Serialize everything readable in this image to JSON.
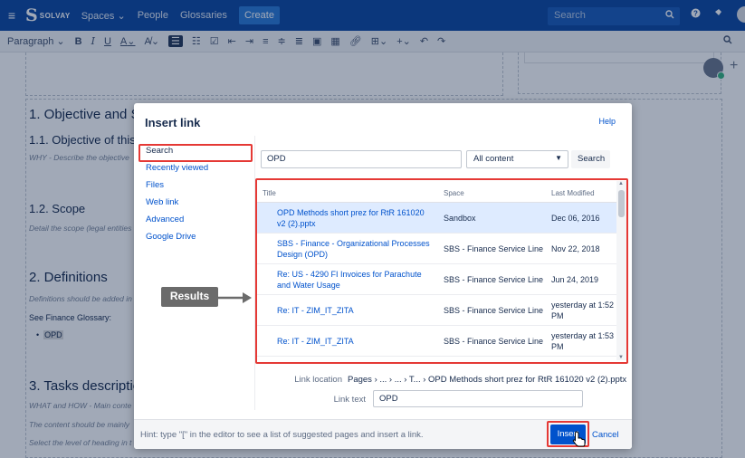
{
  "topnav": {
    "brand": "SOLVAY",
    "items": [
      "Spaces",
      "People",
      "Glossaries"
    ],
    "spaces_caret": "⌄",
    "create_label": "Create",
    "search_placeholder": "Search"
  },
  "toolbar": {
    "paragraph_label": "Paragraph",
    "bold": "B",
    "italic": "I",
    "underline": "U",
    "text_color": "A",
    "more_format": "A̸"
  },
  "editor": {
    "h1_objective": "1. Objective and S",
    "h2_objective": "1.1. Objective of this",
    "hint_objective": "WHY - Describe the objective",
    "h2_scope": "1.2. Scope",
    "hint_scope": "Detail the scope (legal entities",
    "h1_definitions": "2. Definitions",
    "hint_definitions": "Definitions should be added in",
    "see_glossary": "See Finance Glossary:",
    "bullet_opd": "OPD",
    "h1_tasks": "3. Tasks descriptio",
    "hint_tasks1": "WHAT and HOW - Main conte",
    "hint_tasks2": "The content should be mainly",
    "hint_tasks3": "Select the level of heading in t"
  },
  "dialog": {
    "title": "Insert link",
    "help_label": "Help",
    "sidebar": [
      {
        "label": "Search",
        "active": true
      },
      {
        "label": "Recently viewed",
        "active": false
      },
      {
        "label": "Files",
        "active": false
      },
      {
        "label": "Web link",
        "active": false
      },
      {
        "label": "Advanced",
        "active": false
      },
      {
        "label": "Google Drive",
        "active": false
      }
    ],
    "search_value": "OPD",
    "content_filter": "All content",
    "search_button": "Search",
    "columns": {
      "title": "Title",
      "space": "Space",
      "modified": "Last Modified"
    },
    "results": [
      {
        "title": "OPD Methods short prez for RtR 161020 v2 (2).pptx",
        "space": "Sandbox",
        "modified": "Dec 06, 2016",
        "selected": true
      },
      {
        "title": "SBS - Finance - Organizational Processes Design (OPD)",
        "space": "SBS - Finance Service Line",
        "modified": "Nov 22, 2018",
        "selected": false
      },
      {
        "title": "Re: US - 4290 FI Invoices for Parachute and Water Usage",
        "space": "SBS - Finance Service Line",
        "modified": "Jun 24, 2019",
        "selected": false
      },
      {
        "title": "Re: IT - ZIM_IT_ZITA",
        "space": "SBS - Finance Service Line",
        "modified": "yesterday at 1:52 PM",
        "selected": false
      },
      {
        "title": "Re: IT - ZIM_IT_ZITA",
        "space": "SBS - Finance Service Line",
        "modified": "yesterday at 1:53 PM",
        "selected": false
      }
    ],
    "annotation_label": "Results",
    "link_location_label": "Link location",
    "link_location_value": "Pages › ... › ... › T... › OPD Methods short prez for RtR 161020 v2 (2).pptx",
    "link_text_label": "Link text",
    "link_text_value": "OPD",
    "footer_hint": "Hint: type \"[\" in the editor to see a list of suggested pages and insert a link.",
    "insert_button": "Insert",
    "cancel_link": "Cancel"
  },
  "colors": {
    "nav_blue": "#0d47a1",
    "link_blue": "#0052cc",
    "highlight_red": "#e53935",
    "selected_row": "#deebff"
  }
}
